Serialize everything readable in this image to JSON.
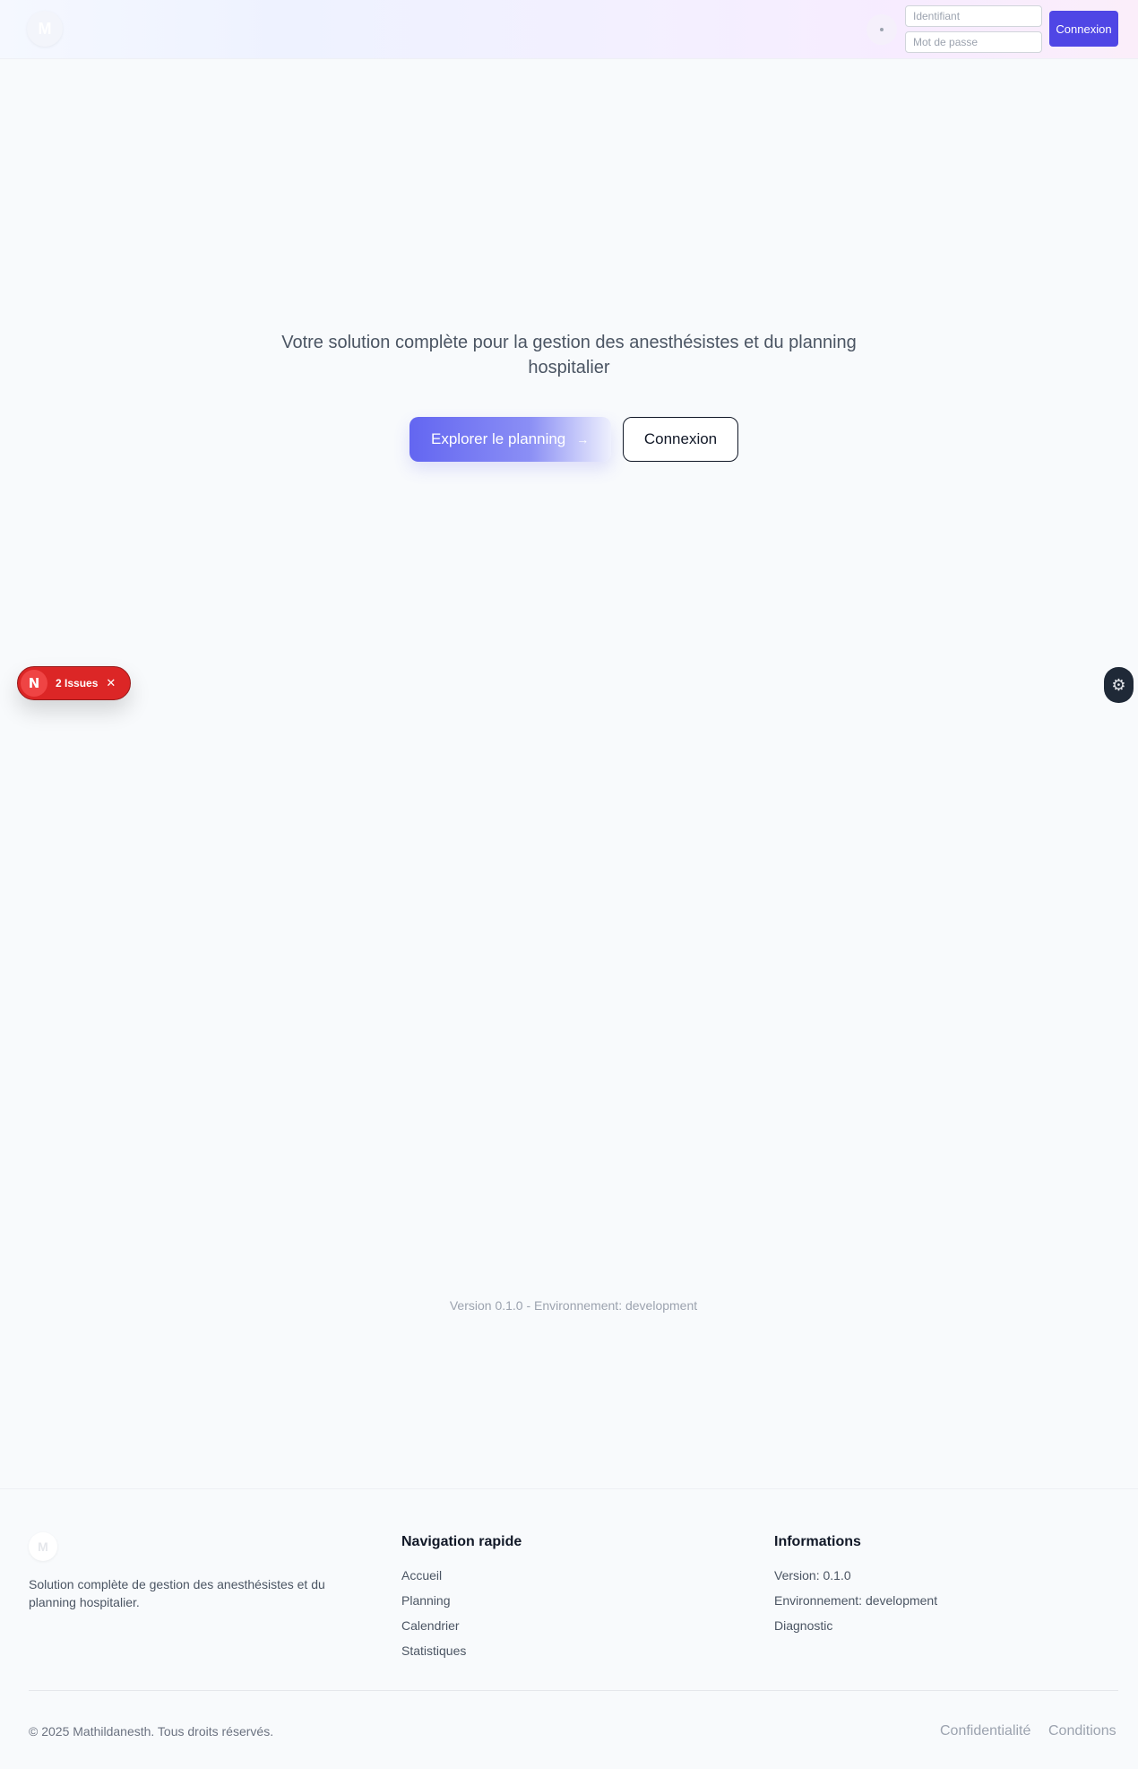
{
  "header": {
    "logo_letter": "M",
    "username_placeholder": "Identifiant",
    "password_placeholder": "Mot de passe",
    "login_label": "Connexion"
  },
  "hero": {
    "subtitle": "Votre solution complète pour la gestion des anesthésistes et du planning hospitalier",
    "explore_label": "Explorer le planning",
    "explore_arrow": "→",
    "login_label": "Connexion"
  },
  "dev_overlay": {
    "badge_letter": "N",
    "issues_label": "2 Issues",
    "close_glyph": "✕",
    "tool_glyph": "⚙"
  },
  "version_line": "Version 0.1.0 - Environnement: development",
  "footer": {
    "logo_letter": "M",
    "description": "Solution complète de gestion des anesthésistes et du planning hospitalier.",
    "nav": {
      "title": "Navigation rapide",
      "links": [
        "Accueil",
        "Planning",
        "Calendrier",
        "Statistiques"
      ]
    },
    "info": {
      "title": "Informations",
      "items": [
        "Version: 0.1.0",
        "Environnement: development",
        "Diagnostic"
      ]
    },
    "copyright": "© 2025 Mathildanesth. Tous droits réservés.",
    "privacy_label": "Confidentialité",
    "terms_label": "Conditions"
  },
  "colors": {
    "accent": "#4f46e5",
    "issues_red": "#dc2626"
  }
}
